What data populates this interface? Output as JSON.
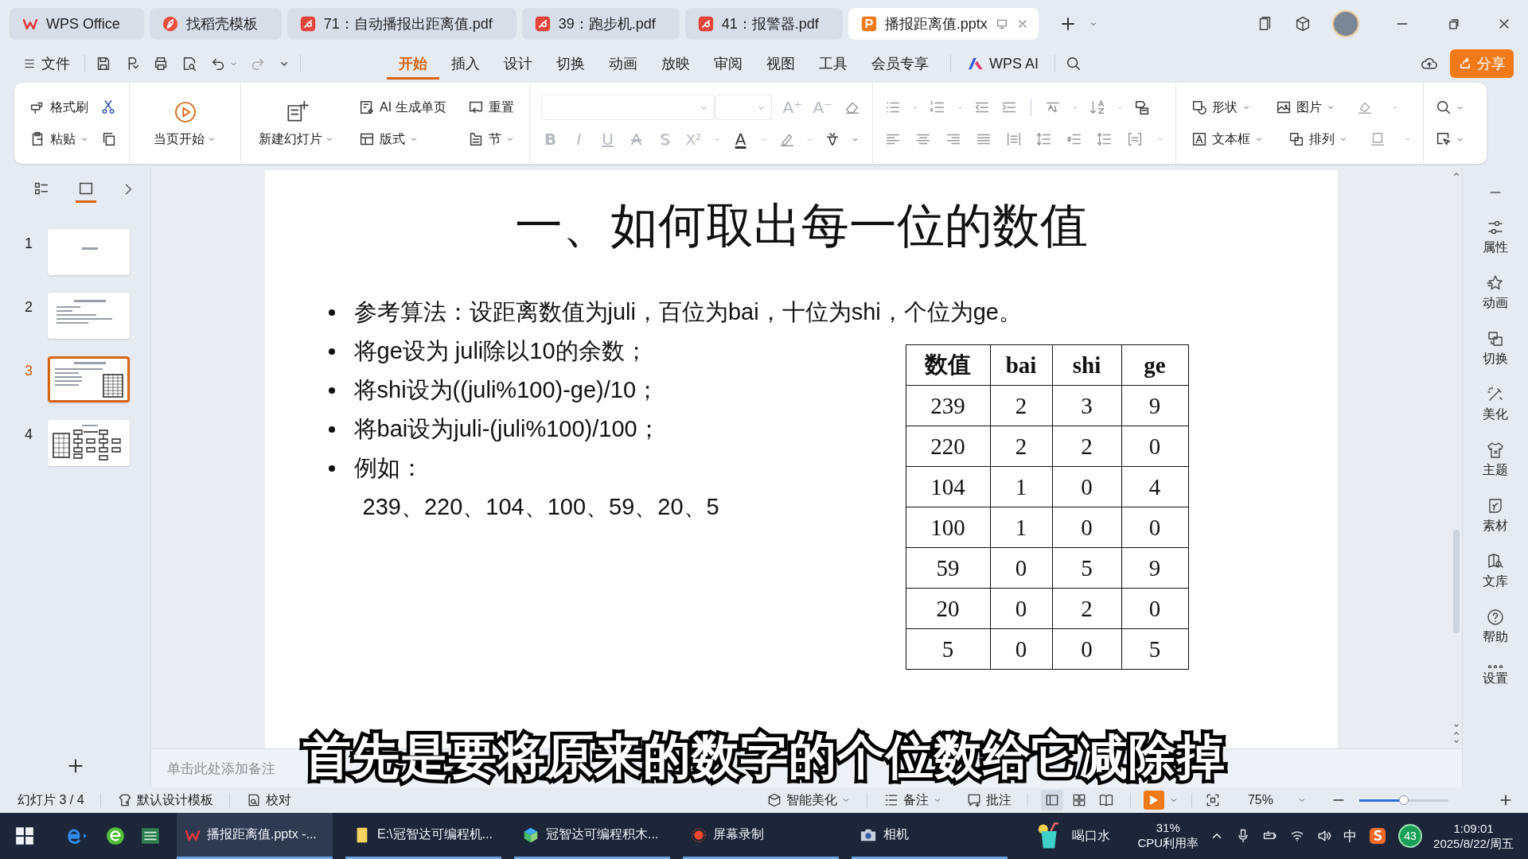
{
  "tabs": [
    {
      "label": "WPS Office",
      "kind": "wps",
      "selected": false
    },
    {
      "label": "找稻壳模板",
      "kind": "template",
      "selected": false
    },
    {
      "label": "71：自动播报出距离值.pdf",
      "kind": "pdf",
      "selected": false
    },
    {
      "label": "39：跑步机.pdf",
      "kind": "pdf",
      "selected": false
    },
    {
      "label": "41：报警器.pdf",
      "kind": "pdf",
      "selected": false
    },
    {
      "label": "播报距离值.pptx",
      "kind": "pptx",
      "selected": true
    }
  ],
  "menu": {
    "file": "文件",
    "tabs": [
      {
        "label": "开始",
        "selected": true
      },
      {
        "label": "插入",
        "selected": false
      },
      {
        "label": "设计",
        "selected": false
      },
      {
        "label": "切换",
        "selected": false
      },
      {
        "label": "动画",
        "selected": false
      },
      {
        "label": "放映",
        "selected": false
      },
      {
        "label": "审阅",
        "selected": false
      },
      {
        "label": "视图",
        "selected": false
      },
      {
        "label": "工具",
        "selected": false
      },
      {
        "label": "会员专享",
        "selected": false
      }
    ],
    "ai": "WPS AI",
    "share": "分享"
  },
  "ribbon": {
    "format_painter": "格式刷",
    "paste": "粘贴",
    "start_here": "当页开始",
    "new_slide": "新建幻灯片",
    "ai_page": "AI 生成单页",
    "layout": "版式",
    "reset": "重置",
    "section": "节",
    "size_buttons": [
      {
        "glyph": "A⁺",
        "disabled": true
      },
      {
        "glyph": "A⁻",
        "disabled": true
      }
    ],
    "font_buttons": [
      {
        "glyph": "B",
        "kind": "bold",
        "disabled": true
      },
      {
        "glyph": "I",
        "kind": "italic",
        "disabled": true
      },
      {
        "glyph": "U",
        "kind": "underline",
        "disabled": true
      },
      {
        "glyph": "A",
        "kind": "strikethrough",
        "disabled": true
      },
      {
        "glyph": "S",
        "kind": "shadow",
        "disabled": true
      },
      {
        "glyph": "X²",
        "kind": "superscript",
        "disabled": true
      },
      {
        "glyph": "A",
        "kind": "font-color",
        "disabled": false
      }
    ],
    "shape": "形状",
    "picture": "图片",
    "text_box": "文本框",
    "arrange": "排列"
  },
  "panel_views": [
    {
      "kind": "outline",
      "selected": false
    },
    {
      "kind": "slides",
      "selected": true
    }
  ],
  "thumbnails": [
    {
      "number": "1",
      "kind": "title",
      "selected": false
    },
    {
      "number": "2",
      "kind": "text",
      "selected": false
    },
    {
      "number": "3",
      "kind": "text-table",
      "selected": true
    },
    {
      "number": "4",
      "kind": "diagram",
      "selected": false
    }
  ],
  "slide": {
    "title": "一、如何取出每一位的数值",
    "bullets": [
      "参考算法：设距离数值为juli，百位为bai，十位为shi，个位为ge。",
      "将ge设为 juli除以10的余数；",
      "将shi设为((juli%100)-ge)/10；",
      "将bai设为juli-(juli%100)/100；",
      "例如："
    ],
    "example": "239、220、104、100、59、20、5",
    "table": {
      "columns": [
        "数值",
        "bai",
        "shi",
        "ge"
      ],
      "rows": [
        [
          "239",
          "2",
          "3",
          "9"
        ],
        [
          "220",
          "2",
          "2",
          "0"
        ],
        [
          "104",
          "1",
          "0",
          "4"
        ],
        [
          "100",
          "1",
          "0",
          "0"
        ],
        [
          "59",
          "0",
          "5",
          "9"
        ],
        [
          "20",
          "0",
          "2",
          "0"
        ],
        [
          "5",
          "0",
          "0",
          "5"
        ]
      ]
    }
  },
  "notes_placeholder": "单击此处添加备注",
  "caption": "首先是要将原来的数字的个位数给它减除掉",
  "sidebar": [
    {
      "label": "属性",
      "kind": "properties"
    },
    {
      "label": "动画",
      "kind": "animation"
    },
    {
      "label": "切换",
      "kind": "transition"
    },
    {
      "label": "美化",
      "kind": "beautify"
    },
    {
      "label": "主题",
      "kind": "theme"
    },
    {
      "label": "素材",
      "kind": "assets"
    },
    {
      "label": "文库",
      "kind": "library"
    },
    {
      "label": "帮助",
      "kind": "help"
    },
    {
      "label": "设置",
      "kind": "settings"
    }
  ],
  "status": {
    "slide_info": "幻灯片 3 / 4",
    "template": "默认设计模板",
    "proofread": "校对",
    "beautify": "智能美化",
    "notes": "备注",
    "comments": "批注",
    "views": [
      {
        "kind": "normal",
        "selected": true
      },
      {
        "kind": "sorter",
        "selected": false
      },
      {
        "kind": "reading",
        "selected": false
      }
    ],
    "zoom": "75%",
    "zoom_slider": {
      "level": 0.5
    }
  },
  "taskbar": {
    "apps": [
      {
        "label": "播报距离值.pptx -...",
        "kind": "wps",
        "selected": true
      },
      {
        "label": "E:\\冠智达可编程机...",
        "kind": "folder",
        "selected": false
      },
      {
        "label": "冠智达可编程积木...",
        "kind": "blocks",
        "selected": false
      },
      {
        "label": "屏幕录制",
        "kind": "record",
        "selected": false
      },
      {
        "label": "相机",
        "kind": "camera",
        "selected": false
      }
    ],
    "widget": "喝口水",
    "cpu_percent": "31%",
    "cpu_label": "CPU利用率",
    "ime": "中",
    "badge": "43",
    "time": "1:09:01",
    "date": "2025/8/22/周五"
  }
}
